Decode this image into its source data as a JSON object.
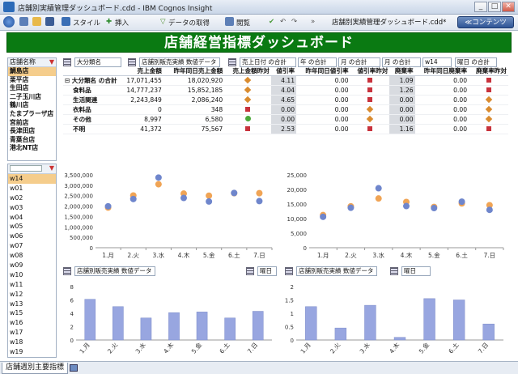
{
  "window": {
    "title": "店舗別実績管理ダッシュボード.cdd - IBM Cognos Insight",
    "min": "_",
    "max": "□",
    "close": "✕"
  },
  "toolbar": {
    "style": "スタイル",
    "insert": "挿入",
    "get_data": "データの取得",
    "browse": "閲覧",
    "context_title": "店舗別実績管理ダッシュボード.cdd*",
    "content_button": "≪コンテンツ"
  },
  "banner": "店舗経営指標ダッシュボード",
  "store_panel": {
    "header": "店舗名称",
    "items": [
      "鯛島店",
      "栗平店",
      "生田店",
      "二子玉川店",
      "鶴川店",
      "たまプラーザ店",
      "宮前店",
      "長津田店",
      "青葉台店",
      "港北NT店"
    ]
  },
  "week_panel": {
    "items": [
      "w14",
      "w01",
      "w02",
      "w03",
      "w04",
      "w05",
      "w06",
      "w07",
      "w08",
      "w09",
      "w10",
      "w11",
      "w12",
      "w13",
      "w15",
      "w16",
      "w17",
      "w18",
      "w19"
    ]
  },
  "filters_top": {
    "f1": "大分類名",
    "f2": "店舗別販売実績 数値データ",
    "f3": "売上日付 の合計",
    "f4": "年 の合計",
    "f5": "月 の合計",
    "f6": "月 の合計",
    "f7": "w14",
    "f8": "曜日 の合計"
  },
  "table": {
    "columns": [
      "売上金額",
      "昨年同日売上金額",
      "売上金額昨対",
      "値引率",
      "昨年同日値引率",
      "値引率昨対",
      "廃棄率",
      "昨年同日廃棄率",
      "廃棄率昨対"
    ],
    "rows": [
      {
        "label": "大分類名 の合計",
        "sales": "17,071,455",
        "ly_sales": "18,020,920",
        "sales_mk": "dia",
        "disc": "4.11",
        "ly_disc": "0.00",
        "disc_mk": "sq",
        "waste": "1.09",
        "ly_waste": "0.00",
        "waste_mk": "sq"
      },
      {
        "label": "食料品",
        "sales": "14,777,237",
        "ly_sales": "15,852,185",
        "sales_mk": "dia",
        "disc": "4.04",
        "ly_disc": "0.00",
        "disc_mk": "sq",
        "waste": "1.26",
        "ly_waste": "0.00",
        "waste_mk": "sq"
      },
      {
        "label": "生活関連",
        "sales": "2,243,849",
        "ly_sales": "2,086,240",
        "sales_mk": "dia",
        "disc": "4.65",
        "ly_disc": "0.00",
        "disc_mk": "sq",
        "waste": "0.00",
        "ly_waste": "0.00",
        "waste_mk": "dia"
      },
      {
        "label": "衣料品",
        "sales": "0",
        "ly_sales": "348",
        "sales_mk": "sq",
        "disc": "0.00",
        "ly_disc": "0.00",
        "disc_mk": "dia",
        "waste": "0.00",
        "ly_waste": "0.00",
        "waste_mk": "dia"
      },
      {
        "label": "その他",
        "sales": "8,997",
        "ly_sales": "6,580",
        "sales_mk": "ci",
        "disc": "0.00",
        "ly_disc": "0.00",
        "disc_mk": "dia",
        "waste": "0.00",
        "ly_waste": "0.00",
        "waste_mk": "dia"
      },
      {
        "label": "不明",
        "sales": "41,372",
        "ly_sales": "75,567",
        "sales_mk": "sq",
        "disc": "2.53",
        "ly_disc": "0.00",
        "disc_mk": "sq",
        "waste": "1.16",
        "ly_waste": "0.00",
        "waste_mk": "sq"
      }
    ]
  },
  "filters_bottom_left": {
    "f1": "店舗別販売実績 数値データ",
    "f2": "曜日"
  },
  "filters_bottom_right": {
    "f1": "店舗別販売実績 数値データ",
    "f2": "曜日"
  },
  "statusbar": {
    "tab": "店舗週別主要指標"
  },
  "colors": {
    "orange": "#f0a455",
    "blue": "#6f86cc",
    "bar": "#98a6e0",
    "banner": "#0a7a12"
  },
  "chart_data": [
    {
      "type": "scatter",
      "categories": [
        "1.月",
        "2.火",
        "3.水",
        "4.木",
        "5.金",
        "6.土",
        "7.日"
      ],
      "ylim": [
        0,
        3500000
      ],
      "yticks": [
        "3,500,000",
        "3,000,000",
        "2,500,000",
        "2,000,000",
        "1,500,000",
        "1,000,000",
        "500,000",
        "0"
      ],
      "series": [
        {
          "values": [
            1930000,
            2510000,
            3050000,
            2600000,
            2500000,
            2620000,
            2620000
          ]
        },
        {
          "values": [
            1990000,
            2340000,
            3370000,
            2390000,
            2220000,
            2630000,
            2240000
          ]
        }
      ]
    },
    {
      "type": "scatter",
      "categories": [
        "1.月",
        "2.火",
        "3.水",
        "4.木",
        "5.金",
        "6.土",
        "7.日"
      ],
      "ylim": [
        0,
        25000
      ],
      "yticks": [
        "25,000",
        "20,000",
        "15,000",
        "10,000",
        "5,000",
        "0"
      ],
      "series": [
        {
          "values": [
            11200,
            14200,
            16900,
            15700,
            14000,
            15200,
            14600
          ]
        },
        {
          "values": [
            10600,
            13700,
            20400,
            14300,
            13600,
            15800,
            13000
          ]
        }
      ]
    },
    {
      "type": "bar",
      "categories": [
        "1.月",
        "2.火",
        "3.水",
        "4.木",
        "5.金",
        "6.土",
        "7.日"
      ],
      "values": [
        6.1,
        5.0,
        3.3,
        4.1,
        4.2,
        3.3,
        4.3
      ],
      "ylim": [
        0,
        8
      ],
      "yticks": [
        "8",
        "6",
        "4",
        "2",
        "0"
      ]
    },
    {
      "type": "bar",
      "categories": [
        "1.月",
        "2.火",
        "3.水",
        "4.木",
        "5.金",
        "6.土",
        "7.日"
      ],
      "values": [
        1.25,
        0.45,
        1.3,
        0.1,
        1.55,
        1.5,
        0.6
      ],
      "ylim": [
        0,
        2
      ],
      "yticks": [
        "2",
        "1.5",
        "1",
        "0.5",
        "0"
      ]
    }
  ]
}
